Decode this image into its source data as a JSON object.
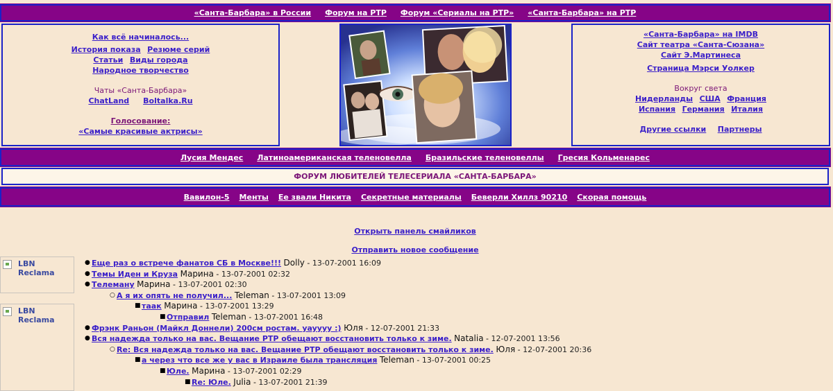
{
  "top_nav": [
    "«Санта-Барбара» в России",
    "Форум на РТР",
    "Форум «Сериалы на РТР»",
    "«Санта-Барбара» на РТР"
  ],
  "left_panel": {
    "how_it_began": "Как всё начиналось...",
    "show_history": "История показа",
    "episode_summary": "Резюме серий",
    "articles": "Статьи",
    "city_views": "Виды города",
    "folk_art": "Народное творчество",
    "chats_label": "Чаты «Санта-Барбара»",
    "chatland": "ChatLand",
    "boltalka": "Boltalka.Ru",
    "voting": "Голосование:",
    "voting_topic": "«Самые красивые актрисы»"
  },
  "right_panel": {
    "imdb": "«Санта-Барбара» на IMDB",
    "theatre": "Сайт театра «Санта-Сюзана»",
    "martinez": "Сайт Э.Мартинеса",
    "mercy": "Страница Мэрси Уолкер",
    "around_world": "Вокруг света",
    "netherlands": "Нидерланды",
    "usa": "США",
    "france": "Франция",
    "spain": "Испания",
    "germany": "Германия",
    "italy": "Италия",
    "other_links": "Другие ссылки",
    "partners": "Партнеры"
  },
  "mid_nav": [
    "Лусия Мендес",
    "Латиноамериканская теленовелла",
    "Бразильские теленовеллы",
    "Гресия Кольменарес"
  ],
  "forum_title": "ФОРУМ ЛЮБИТЕЛЕЙ ТЕЛЕСЕРИАЛА «САНТА-БАРБАРА»",
  "bottom_nav": [
    "Вавилон-5",
    "Менты",
    "Ее звали Никита",
    "Секретные материалы",
    "Беверли Хиллз 90210",
    "Скорая помощь"
  ],
  "open_smileys": "Открыть панель смайликов",
  "new_message": "Отправить новое сообщение",
  "ad_label": "LBN Reclama",
  "messages": [
    {
      "level": 0,
      "title": "Еще раз о встрече фанатов СБ в Москве!!!",
      "author": "Dolly",
      "date": "13-07-2001 16:09"
    },
    {
      "level": 0,
      "title": "Темы Иден и Круза",
      "author": "Марина",
      "date": "13-07-2001 02:32"
    },
    {
      "level": 0,
      "title": "Телеману",
      "author": "Марина",
      "date": "13-07-2001 02:30"
    },
    {
      "level": 1,
      "title": "А я их опять не получил...",
      "author": "Teleman",
      "date": "13-07-2001 13:09"
    },
    {
      "level": 2,
      "title": "таак",
      "author": "Марина",
      "date": "13-07-2001 13:29"
    },
    {
      "level": 3,
      "title": "Отправил",
      "author": "Teleman",
      "date": "13-07-2001 16:48"
    },
    {
      "level": 0,
      "title": "Фрэнк Раньон (Майкл Доннели) 200см ростам. yayyyy :)",
      "author": "Юля",
      "date": "12-07-2001 21:33"
    },
    {
      "level": 0,
      "title": "Вся надежда только на вас. Вещание РТР обещают восстановить только к зиме.",
      "author": "Natalia",
      "date": "12-07-2001 13:56"
    },
    {
      "level": 1,
      "title": "Re: Вся надежда только на вас. Вещание РТР обещают восстановить только к зиме.",
      "author": "Юля",
      "date": "12-07-2001 20:36"
    },
    {
      "level": 2,
      "title": "а через что все же у вас в Израиле была трансляция",
      "author": "Teleman",
      "date": "13-07-2001 00:25"
    },
    {
      "level": 3,
      "title": "Юле.",
      "author": "Марина",
      "date": "13-07-2001 02:29"
    },
    {
      "level": 4,
      "title": "Re: Юле.",
      "author": "Julia",
      "date": "13-07-2001 21:39"
    }
  ],
  "colors": {
    "background": "#f7e7d2",
    "purple_bar": "#860487",
    "border_blue": "#1a22c8",
    "link": "#3a1fc9"
  }
}
